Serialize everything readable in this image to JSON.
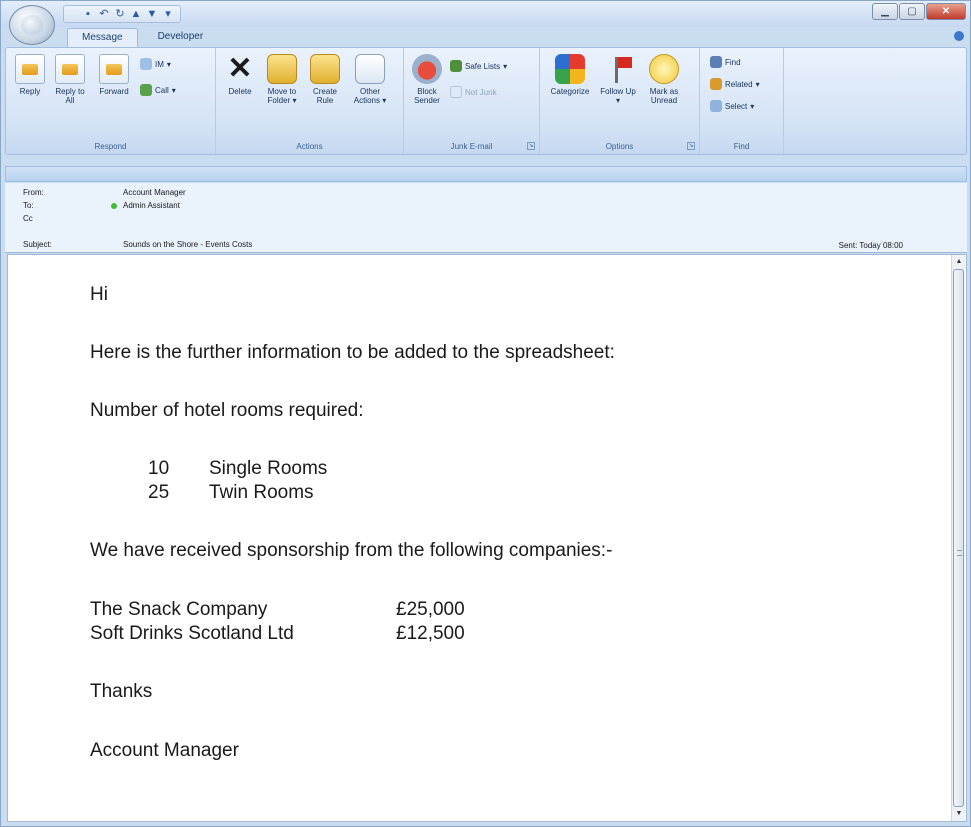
{
  "qat": {
    "icons": [
      "save-icon",
      "undo-icon",
      "redo-icon",
      "up-icon",
      "down-icon",
      "customize-icon"
    ]
  },
  "tabs": [
    {
      "label": "Message"
    },
    {
      "label": "Developer"
    }
  ],
  "ribbon": {
    "respond": {
      "label": "Respond",
      "reply": "Reply",
      "reply_all": "Reply to All",
      "forward": "Forward",
      "im": "IM",
      "call": "Call"
    },
    "actions": {
      "label": "Actions",
      "delete": "Delete",
      "move_to_folder": "Move to Folder",
      "create_rule": "Create Rule",
      "other_actions": "Other Actions"
    },
    "junk": {
      "label": "Junk E-mail",
      "block_sender": "Block Sender",
      "safe_lists": "Safe Lists",
      "not_junk": "Not Junk"
    },
    "options": {
      "label": "Options",
      "categorize": "Categorize",
      "follow_up": "Follow Up",
      "mark_as_unread": "Mark as Unread"
    },
    "find": {
      "label": "Find",
      "find": "Find",
      "related": "Related",
      "select": "Select"
    }
  },
  "header": {
    "from_label": "From:",
    "from_value": "Account Manager",
    "to_label": "To:",
    "to_value": "Admin Assistant",
    "cc_label": "Cc",
    "subject_label": "Subject:",
    "subject_value": "Sounds on the Shore - Events Costs",
    "sent": "Sent: Today 08:00",
    "presence_color": "#3fbf2f"
  },
  "message": {
    "greeting": "Hi",
    "intro": "Here is the further information to be added to the spreadsheet:",
    "rooms_heading": "Number of hotel rooms required:",
    "rooms": [
      {
        "qty": "10",
        "type": "Single Rooms"
      },
      {
        "qty": "25",
        "type": "Twin Rooms"
      }
    ],
    "sponsor_heading": "We have received sponsorship from the following companies:-",
    "sponsors": [
      {
        "name": "The Snack Company",
        "amount": "£25,000"
      },
      {
        "name": "Soft Drinks Scotland Ltd",
        "amount": "£12,500"
      }
    ],
    "thanks": "Thanks",
    "signature": "Account Manager"
  }
}
